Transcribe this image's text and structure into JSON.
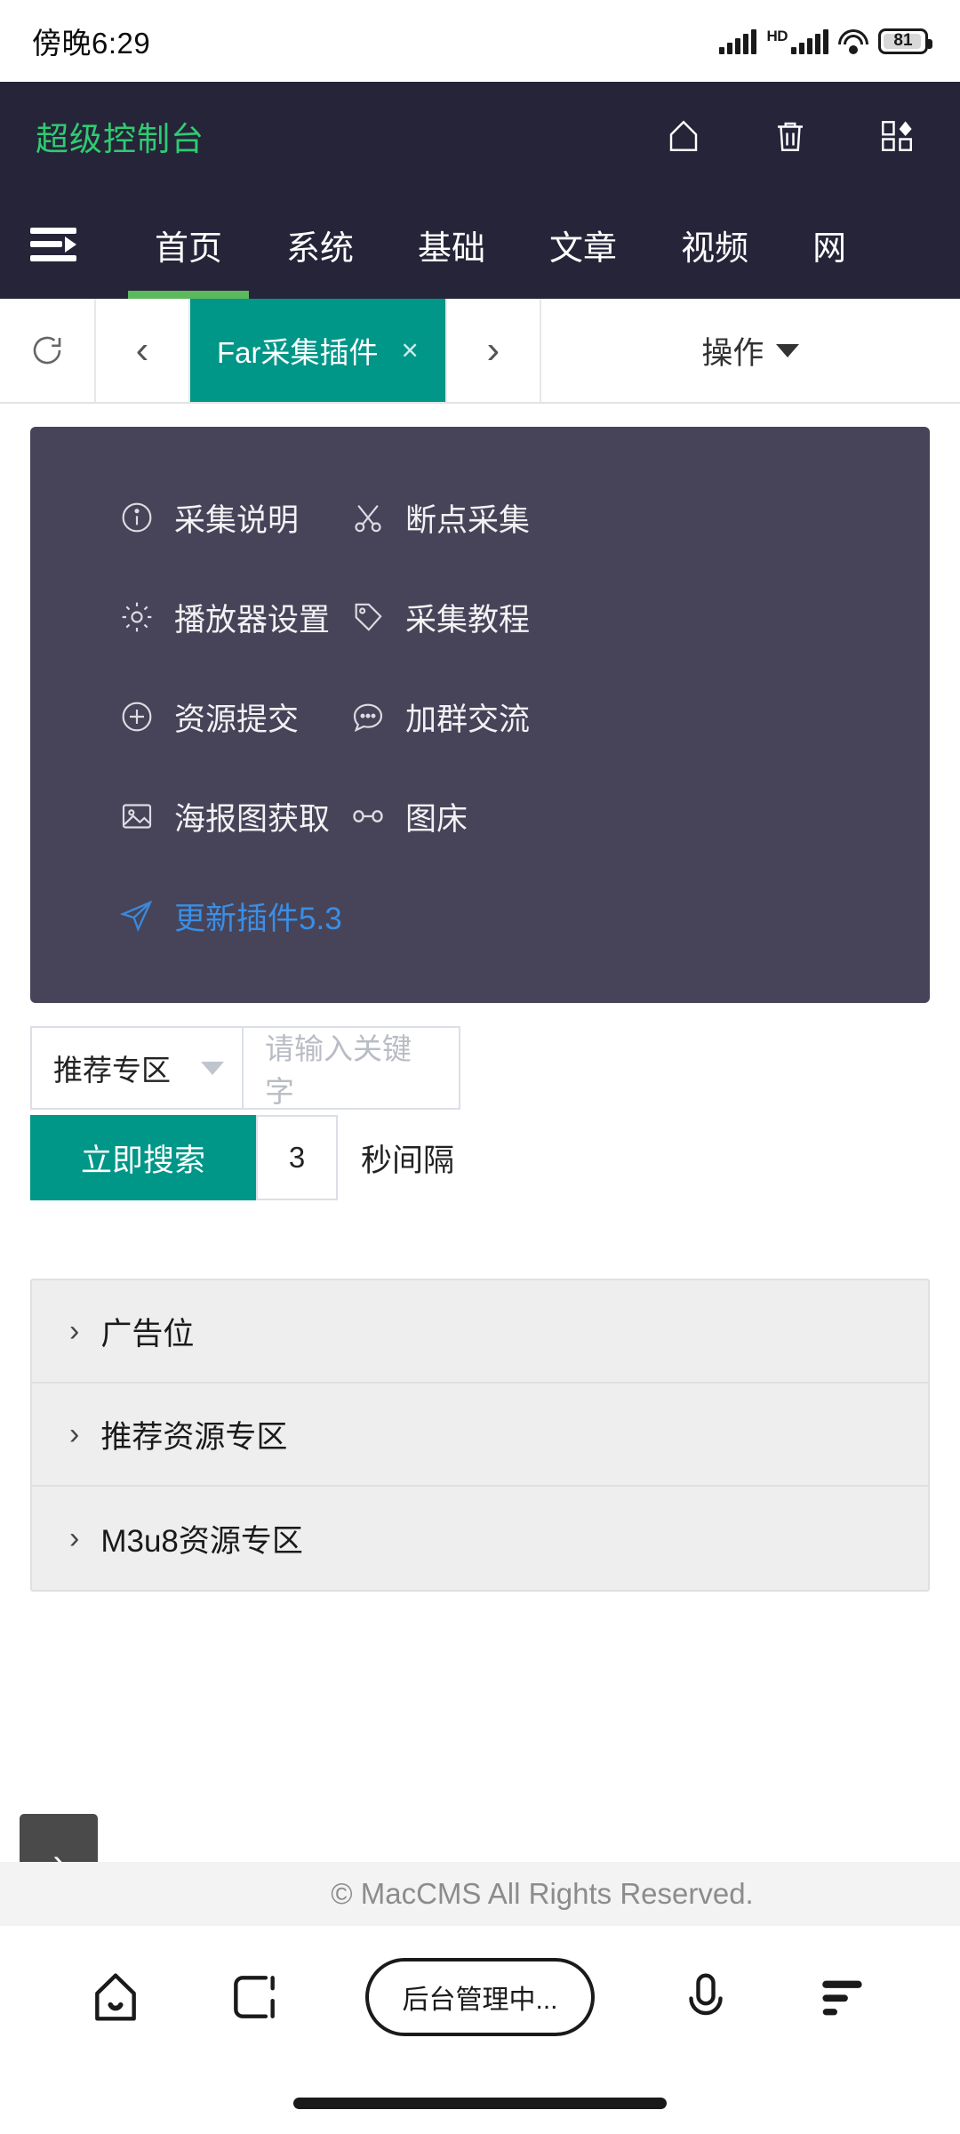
{
  "status_bar": {
    "time": "傍晚6:29",
    "network_label": "HD",
    "battery_percent": "81",
    "icons": [
      "signal-bars-icon",
      "hd-icon",
      "signal-bars-icon",
      "wifi-icon",
      "battery-icon"
    ]
  },
  "app_header": {
    "brand": "超级控制台",
    "brand_color": "#2ecc71",
    "background": "#262438",
    "icons": [
      {
        "name": "home-icon",
        "label": "首页"
      },
      {
        "name": "trash-icon",
        "label": "清空缓存"
      },
      {
        "name": "apps-grid-icon",
        "label": "应用"
      }
    ]
  },
  "nav": {
    "menu_icon": "menu-indent-icon",
    "tabs": [
      {
        "label": "首页",
        "active": true
      },
      {
        "label": "系统",
        "active": false
      },
      {
        "label": "基础",
        "active": false
      },
      {
        "label": "文章",
        "active": false
      },
      {
        "label": "视频",
        "active": false
      },
      {
        "label": "网",
        "active": false
      }
    ],
    "active_underline_color": "#5cb85c"
  },
  "toolbar": {
    "refresh_icon": "refresh-icon",
    "prev_label": "‹",
    "next_label": "›",
    "tab": {
      "label": "Far采集插件",
      "close": "×",
      "color": "#009688"
    },
    "operations_label": "操作"
  },
  "panel": {
    "background": "#474459",
    "rows": [
      [
        {
          "icon": "info-circle-icon",
          "label": "采集说明"
        },
        {
          "icon": "scissors-icon",
          "label": "断点采集"
        }
      ],
      [
        {
          "icon": "gear-icon",
          "label": "播放器设置"
        },
        {
          "icon": "tag-icon",
          "label": "采集教程"
        }
      ],
      [
        {
          "icon": "plus-circle-icon",
          "label": "资源提交"
        },
        {
          "icon": "chat-bubble-icon",
          "label": "加群交流"
        }
      ],
      [
        {
          "icon": "image-icon",
          "label": "海报图获取"
        },
        {
          "icon": "link-infinity-icon",
          "label": "图床"
        }
      ],
      [
        {
          "icon": "send-plane-icon",
          "label": "更新插件5.3",
          "color": "#3a8ee6"
        }
      ]
    ]
  },
  "search_form": {
    "category_value": "推荐专区",
    "keyword_placeholder": "请输入关键字",
    "search_button": "立即搜索",
    "interval_value": "3",
    "interval_unit": "秒间隔"
  },
  "accordion": {
    "items": [
      {
        "chevron": "›",
        "label": "广告位"
      },
      {
        "chevron": "›",
        "label": "推荐资源专区"
      },
      {
        "chevron": "›",
        "label": "M3u8资源专区"
      }
    ]
  },
  "float_tab": {
    "icon": "chevron-right-icon",
    "label": "›"
  },
  "footer": {
    "text": "© MacCMS All Rights Reserved."
  },
  "bottom_nav": {
    "items": [
      {
        "name": "browser-home-icon",
        "type": "icon"
      },
      {
        "name": "browser-tabs-icon",
        "type": "icon"
      },
      {
        "name": "address-pill",
        "type": "pill",
        "label": "后台管理中..."
      },
      {
        "name": "microphone-icon",
        "type": "icon"
      },
      {
        "name": "browser-menu-icon",
        "type": "icon"
      }
    ]
  }
}
